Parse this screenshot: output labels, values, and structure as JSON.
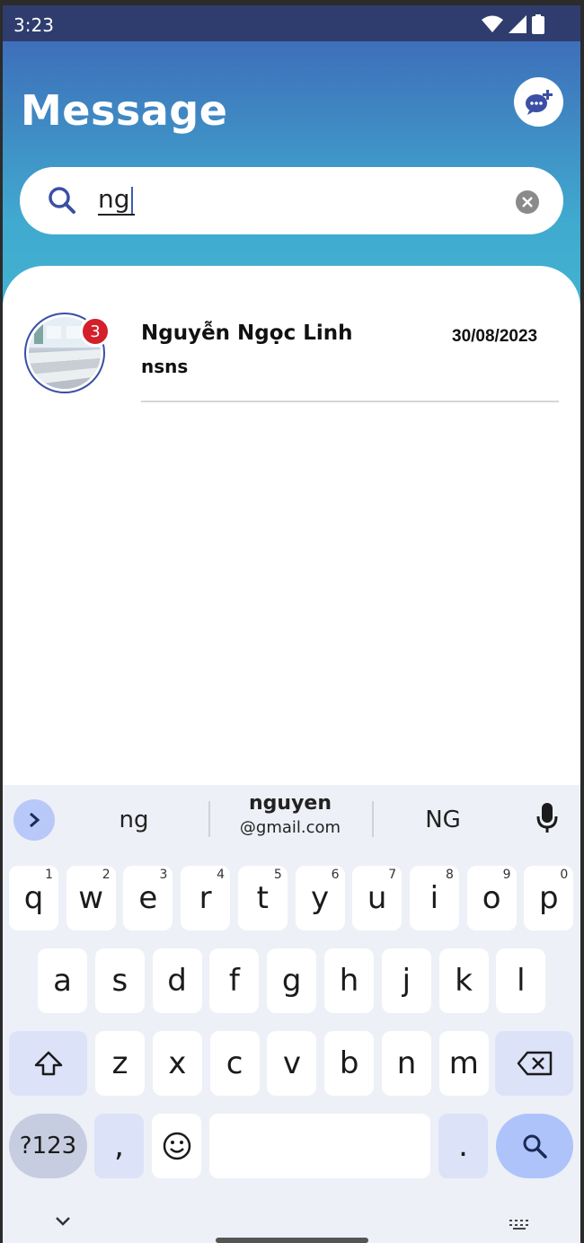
{
  "status": {
    "time": "3:23"
  },
  "header": {
    "title": "Message"
  },
  "search": {
    "value": "ng"
  },
  "chats": [
    {
      "name": "Nguyễn Ngọc Linh",
      "preview": "nsns",
      "date": "30/08/2023",
      "unread": "3"
    }
  ],
  "keyboard": {
    "suggestions": {
      "left": "ng",
      "middle_top": "nguyen",
      "middle_bottom": "@gmail.com",
      "right": "NG"
    },
    "row1": [
      {
        "k": "q",
        "h": "1"
      },
      {
        "k": "w",
        "h": "2"
      },
      {
        "k": "e",
        "h": "3"
      },
      {
        "k": "r",
        "h": "4"
      },
      {
        "k": "t",
        "h": "5"
      },
      {
        "k": "y",
        "h": "6"
      },
      {
        "k": "u",
        "h": "7"
      },
      {
        "k": "i",
        "h": "8"
      },
      {
        "k": "o",
        "h": "9"
      },
      {
        "k": "p",
        "h": "0"
      }
    ],
    "row2": [
      "a",
      "s",
      "d",
      "f",
      "g",
      "h",
      "j",
      "k",
      "l"
    ],
    "row3": [
      "z",
      "x",
      "c",
      "v",
      "b",
      "n",
      "m"
    ],
    "symbols_label": "?123",
    "comma": ",",
    "period": "."
  },
  "colors": {
    "header_top": "#3d63b6",
    "header_bottom": "#42b3d1",
    "badge": "#d3202a",
    "accent": "#3a5fb6"
  }
}
